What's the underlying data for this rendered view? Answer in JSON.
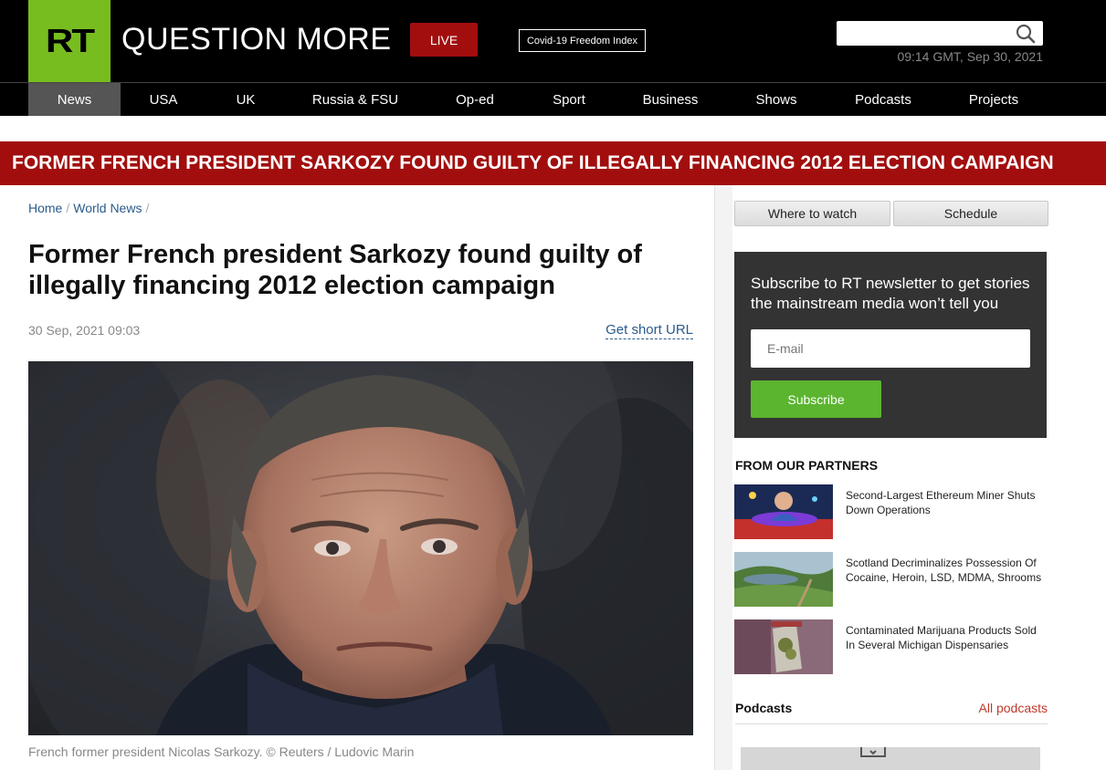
{
  "header": {
    "logo_text": "RT",
    "tagline": "QUESTION MORE",
    "live_label": "LIVE",
    "covid_label": "Covid-19 Freedom Index",
    "search_placeholder": "",
    "datetime": "09:14 GMT, Sep 30, 2021"
  },
  "nav": {
    "items": [
      "News",
      "USA",
      "UK",
      "Russia & FSU",
      "Op-ed",
      "Sport",
      "Business",
      "Shows",
      "Podcasts",
      "Projects"
    ],
    "active": "News"
  },
  "breaking": "FORMER FRENCH PRESIDENT SARKOZY FOUND GUILTY OF ILLEGALLY FINANCING 2012 ELECTION CAMPAIGN",
  "article": {
    "breadcrumb": [
      "Home",
      "World News"
    ],
    "title": "Former French president Sarkozy found guilty of illegally financing 2012 election campaign",
    "date": "30 Sep, 2021 09:03",
    "short_url_label": "Get short URL",
    "caption": "French former president Nicolas Sarkozy. © Reuters / Ludovic Marin"
  },
  "sidebar": {
    "where_to_watch": "Where to watch",
    "schedule": "Schedule",
    "newsletter": {
      "text": "Subscribe to RT newsletter to get stories the mainstream media won’t tell you",
      "email_placeholder": "E-mail",
      "subscribe_label": "Subscribe"
    },
    "partners_title": "FROM OUR PARTNERS",
    "partners": [
      {
        "text": "Second-Largest Ethereum Miner Shuts Down Operations"
      },
      {
        "text": "Scotland Decriminalizes Possession Of Cocaine, Heroin, LSD, MDMA, Shrooms"
      },
      {
        "text": "Contaminated Marijuana Products Sold In Several Michigan Dispensaries"
      }
    ],
    "podcasts_label": "Podcasts",
    "all_podcasts_label": "All podcasts"
  },
  "colors": {
    "brand_green": "#77bd1f",
    "brand_red": "#a20e0e",
    "link_blue": "#2a5b8c",
    "subscribe_green": "#5bb52f"
  }
}
